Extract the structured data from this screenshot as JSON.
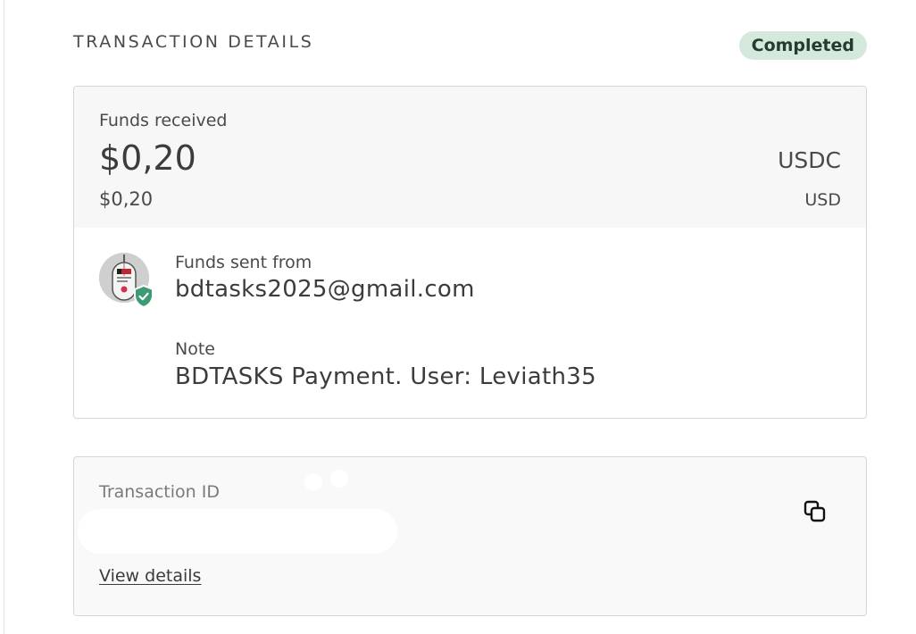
{
  "header": {
    "title": "TRANSACTION DETAILS",
    "status": "Completed"
  },
  "funds": {
    "label": "Funds received",
    "amount": "$0,20",
    "currency": "USDC",
    "converted_amount": "$0,20",
    "converted_currency": "USD"
  },
  "sender": {
    "label": "Funds sent from",
    "email": "bdtasks2025@gmail.com",
    "avatar_icon": "mouse-logo-icon",
    "verified_icon": "shield-check-icon",
    "verified_color": "#3d9b73"
  },
  "note": {
    "label": "Note",
    "text": "BDTASKS Payment. User: Leviath35"
  },
  "transaction": {
    "label": "Transaction ID",
    "copy_icon": "copy-icon",
    "link_label": "View details"
  },
  "colors": {
    "status_bg": "#d4e9dc",
    "status_text": "#243c2e",
    "card_bg": "#f7f7f7",
    "border": "#d6d6d6"
  }
}
